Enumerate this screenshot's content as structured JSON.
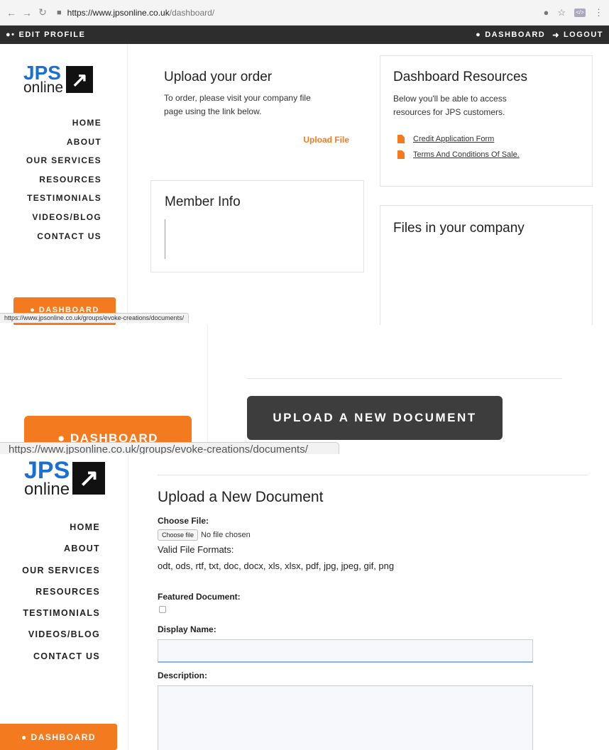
{
  "browser": {
    "url_host": "https://www.jpsonline.co.uk",
    "url_path": "/dashboard/"
  },
  "topbar": {
    "edit_profile": "EDIT PROFILE",
    "dashboard": "DASHBOARD",
    "logout": "LOGOUT"
  },
  "logo": {
    "jps": "JPS",
    "online": "online"
  },
  "nav": [
    "HOME",
    "ABOUT",
    "OUR SERVICES",
    "RESOURCES",
    "TESTIMONIALS",
    "VIDEOS/BLOG",
    "CONTACT US"
  ],
  "sidebar_button": "DASHBOARD",
  "upload_order": {
    "title": "Upload your order",
    "text": "To order, please visit your company file page using the link below.",
    "link": "Upload File"
  },
  "member_info": {
    "title": "Member Info"
  },
  "resources": {
    "title": "Dashboard Resources",
    "text": "Below you'll be able to access resources for JPS customers.",
    "links": [
      "Credit Application Form",
      "Terms And Conditions Of Sale."
    ]
  },
  "files": {
    "title": "Files in your company"
  },
  "status_url": "https://www.jpsonline.co.uk/groups/evoke-creations/documents/",
  "zoom": {
    "upload_button": "UPLOAD A NEW DOCUMENT",
    "dashboard_button": "DASHBOARD",
    "status_url": "https://www.jpsonline.co.uk/groups/evoke-creations/documents/"
  },
  "upload_form": {
    "title": "Upload a New Document",
    "choose_label": "Choose File:",
    "choose_button": "Choose file",
    "no_file": "No file chosen",
    "valid_formats_label": "Valid File Formats:",
    "valid_formats": "odt, ods, rtf, txt, doc, docx, xls, xlsx, pdf, jpg, jpeg, gif, png",
    "featured_label": "Featured Document:",
    "display_name_label": "Display Name:",
    "description_label": "Description:"
  },
  "colors": {
    "accent": "#f47a20",
    "brand_blue": "#1a6fd6",
    "topbar": "#2d2d2d"
  }
}
